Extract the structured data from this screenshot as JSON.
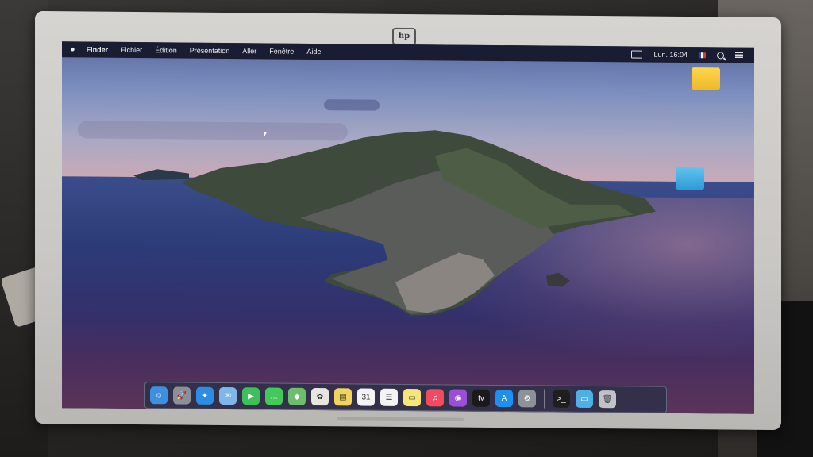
{
  "menubar": {
    "apple_icon": "apple-logo-icon",
    "items": [
      {
        "label": "Finder",
        "bold": true
      },
      {
        "label": "Fichier"
      },
      {
        "label": "Édition"
      },
      {
        "label": "Présentation"
      },
      {
        "label": "Aller"
      },
      {
        "label": "Fenêtre"
      },
      {
        "label": "Aide"
      }
    ],
    "clock": "Lun. 16:04"
  },
  "monitor": {
    "brand": "hp"
  },
  "desktop_icons": [
    {
      "name": "yellow-folder-icon",
      "label": "",
      "color": "#f0b82a"
    },
    {
      "name": "blue-folder-icon",
      "label": "",
      "color": "#2f9ad6"
    }
  ],
  "dock": {
    "apps": [
      {
        "name": "finder-icon",
        "color": "#3d8fe0",
        "glyph": "☺"
      },
      {
        "name": "launchpad-icon",
        "color": "#8a8f9a",
        "glyph": "🚀"
      },
      {
        "name": "safari-icon",
        "color": "#2d8de6",
        "glyph": "✦"
      },
      {
        "name": "mail-icon",
        "color": "#7fb7ea",
        "glyph": "✉"
      },
      {
        "name": "facetime-icon",
        "color": "#3cc057",
        "glyph": "▶"
      },
      {
        "name": "messages-icon",
        "color": "#41c95a",
        "glyph": "…"
      },
      {
        "name": "maps-icon",
        "color": "#6cbf6a",
        "glyph": "◆"
      },
      {
        "name": "photos-icon",
        "color": "#e8e6e0",
        "glyph": "✿"
      },
      {
        "name": "notes-icon",
        "color": "#f2d45c",
        "glyph": "▤"
      },
      {
        "name": "calendar-icon",
        "color": "#f4f4f4",
        "glyph": "31"
      },
      {
        "name": "reminders-icon",
        "color": "#f4f4f4",
        "glyph": "☰"
      },
      {
        "name": "stickies-icon",
        "color": "#f6e67a",
        "glyph": "▭"
      },
      {
        "name": "music-icon",
        "color": "#f04b5e",
        "glyph": "♫"
      },
      {
        "name": "podcasts-icon",
        "color": "#9b4fd8",
        "glyph": "◉"
      },
      {
        "name": "apple-tv-icon",
        "color": "#1a1a1a",
        "glyph": "tv"
      },
      {
        "name": "app-store-icon",
        "color": "#1f8ff0",
        "glyph": "A"
      },
      {
        "name": "system-preferences-icon",
        "color": "#8d9299",
        "glyph": "⚙"
      }
    ],
    "others": [
      {
        "name": "terminal-icon",
        "color": "#1e1e1e",
        "glyph": ">_"
      },
      {
        "name": "downloads-folder-icon",
        "color": "#4fb0e6",
        "glyph": "▭"
      },
      {
        "name": "trash-icon",
        "color": "#bfc3c8",
        "glyph": "🗑"
      }
    ]
  }
}
